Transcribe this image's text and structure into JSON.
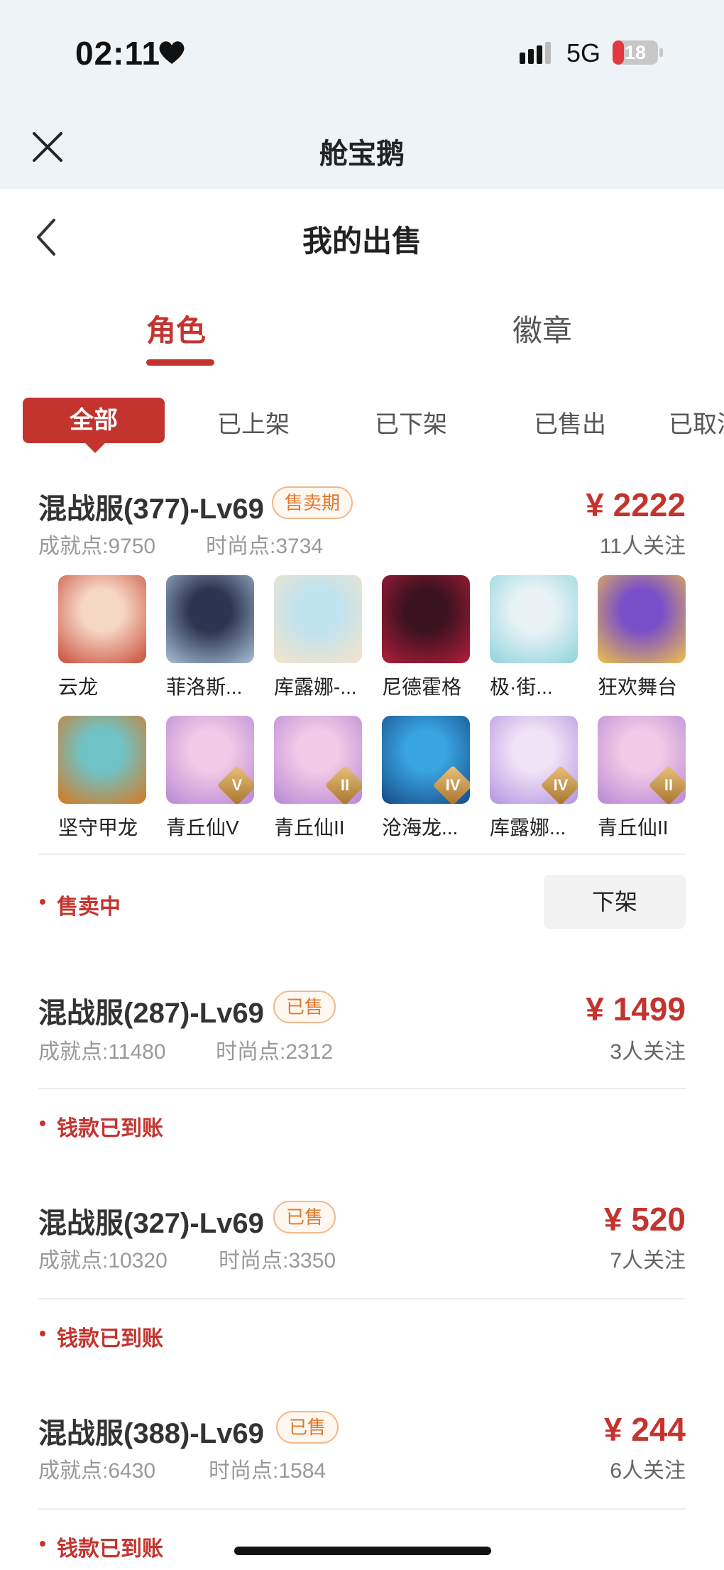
{
  "status_bar": {
    "time": "02:11",
    "network": "5G",
    "battery": "18"
  },
  "app": {
    "title": "舱宝鹅"
  },
  "page": {
    "title": "我的出售"
  },
  "tabs": [
    {
      "label": "角色",
      "active": true
    },
    {
      "label": "徽章",
      "active": false
    }
  ],
  "filters": [
    {
      "label": "全部",
      "active": true
    },
    {
      "label": "已上架"
    },
    {
      "label": "已下架"
    },
    {
      "label": "已售出"
    },
    {
      "label": "已取消"
    }
  ],
  "listings": [
    {
      "title": "混战服(377)-Lv69",
      "badge": "售卖期",
      "achievement": "成就点:9750",
      "fashion": "时尚点:3734",
      "price": "¥ 2222",
      "followers": "11人关注",
      "state": "售卖中",
      "action": "下架",
      "items": [
        {
          "label": "云龙",
          "colors": [
            "#f6d7c4",
            "#c94d3c"
          ]
        },
        {
          "label": "菲洛斯...",
          "colors": [
            "#2b3450",
            "#a8c0d8"
          ]
        },
        {
          "label": "库露娜-...",
          "colors": [
            "#bfe3ef",
            "#f6e3c9"
          ]
        },
        {
          "label": "尼德霍格",
          "colors": [
            "#3a1220",
            "#b21e3a"
          ]
        },
        {
          "label": "极·街...",
          "colors": [
            "#e9f3f6",
            "#8fd3dc"
          ]
        },
        {
          "label": "狂欢舞台",
          "colors": [
            "#7a4fc9",
            "#f0c04a"
          ]
        },
        {
          "label": "坚守甲龙",
          "colors": [
            "#6fc3c7",
            "#d9771e"
          ]
        },
        {
          "label": "青丘仙V",
          "colors": [
            "#f2c9e6",
            "#b888d6"
          ],
          "tier": "V"
        },
        {
          "label": "青丘仙II",
          "colors": [
            "#f2c9e6",
            "#b888d6"
          ],
          "tier": "II"
        },
        {
          "label": "沧海龙...",
          "colors": [
            "#38a4e0",
            "#164a86"
          ],
          "tier": "IV"
        },
        {
          "label": "库露娜...",
          "colors": [
            "#efe3f6",
            "#b494e2"
          ],
          "tier": "IV"
        },
        {
          "label": "青丘仙II",
          "colors": [
            "#f2c9e6",
            "#b888d6"
          ],
          "tier": "II"
        }
      ]
    },
    {
      "title": "混战服(287)-Lv69",
      "badge": "已售",
      "achievement": "成就点:11480",
      "fashion": "时尚点:2312",
      "price": "¥ 1499",
      "followers": "3人关注",
      "state": "钱款已到账"
    },
    {
      "title": "混战服(327)-Lv69",
      "badge": "已售",
      "achievement": "成就点:10320",
      "fashion": "时尚点:3350",
      "price": "¥ 520",
      "followers": "7人关注",
      "state": "钱款已到账"
    },
    {
      "title": "混战服(388)-Lv69",
      "badge": "已售",
      "achievement": "成就点:6430",
      "fashion": "时尚点:1584",
      "price": "¥ 244",
      "followers": "6人关注",
      "state": "钱款已到账"
    }
  ],
  "colors": {
    "accent": "#c4342f",
    "badge_text": "#e0782e",
    "badge_border": "#f2b88b"
  }
}
